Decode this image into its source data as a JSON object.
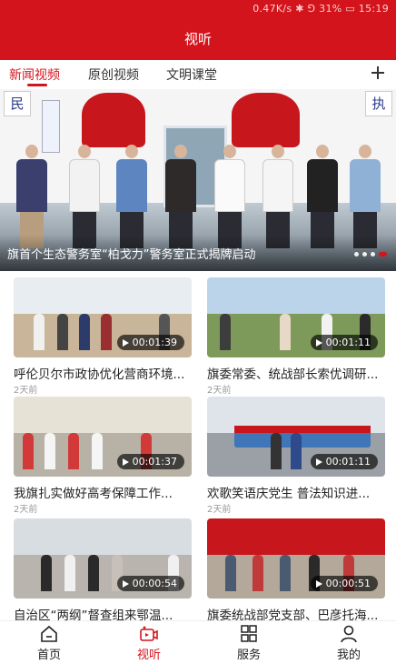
{
  "status_bar": {
    "text": "0.47K/s ✱ ⅁ 31% ▭ 15:19"
  },
  "header": {
    "title": "视听"
  },
  "tabs": [
    {
      "label": "新闻视频",
      "active": true
    },
    {
      "label": "原创视频",
      "active": false
    },
    {
      "label": "文明课堂",
      "active": false
    }
  ],
  "add_icon": "plus-icon",
  "banner": {
    "caption": "旗首个生态警务室“柏戈力”警务室正式揭牌启动",
    "sign_left": "民",
    "sign_right": "执",
    "slides": 4,
    "active_slide": 4
  },
  "videos": [
    {
      "title": "呼伦贝尔市政协优化营商环境",
      "time": "2天前",
      "duration": "00:01:39"
    },
    {
      "title": "旗委常委、统战部长索优调研",
      "time": "2天前",
      "duration": "00:01:11"
    },
    {
      "title": "我旗扎实做好高考保障工作",
      "time": "2天前",
      "duration": "00:01:37"
    },
    {
      "title": "欢歌笑语庆党生 普法知识进",
      "time": "2天前",
      "duration": "00:01:11"
    },
    {
      "title": "自治区“两纲”督查组来鄂温",
      "time": "",
      "duration": "00:00:54"
    },
    {
      "title": "旗委统战部党支部、巴彦托海",
      "time": "",
      "duration": "00:00:51"
    }
  ],
  "bottom_nav": [
    {
      "label": "首页",
      "icon": "home-icon",
      "active": false
    },
    {
      "label": "视听",
      "icon": "video-icon",
      "active": true
    },
    {
      "label": "服务",
      "icon": "grid-icon",
      "active": false
    },
    {
      "label": "我的",
      "icon": "user-icon",
      "active": false
    }
  ],
  "colors": {
    "brand_red": "#d4141c",
    "meta_gray": "#999999"
  }
}
